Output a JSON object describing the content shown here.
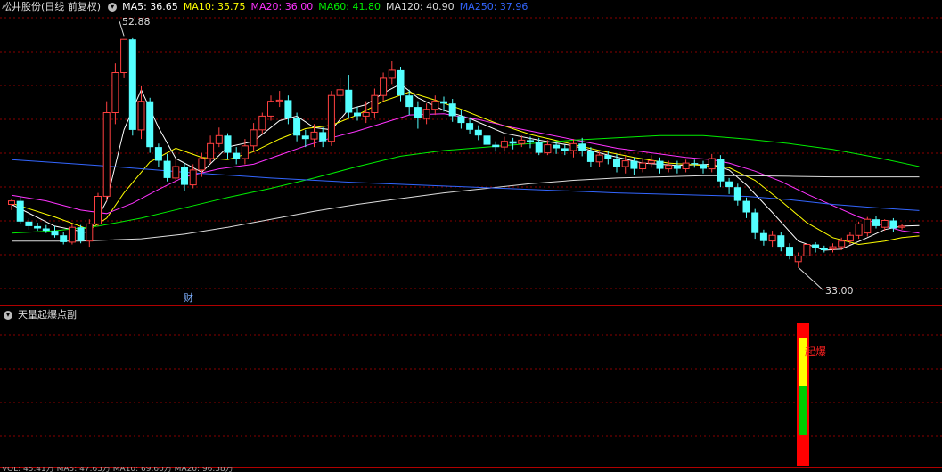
{
  "header": {
    "title": "松井股份(日线 前复权)",
    "ma": [
      {
        "label": "MA5: 36.65",
        "color": "#ffffff"
      },
      {
        "label": "MA10: 35.75",
        "color": "#ffff00"
      },
      {
        "label": "MA20: 36.00",
        "color": "#ff33ff"
      },
      {
        "label": "MA60: 41.80",
        "color": "#00ee00"
      },
      {
        "label": "MA120: 40.90",
        "color": "#dddddd"
      },
      {
        "label": "MA250: 37.96",
        "color": "#3366ff"
      }
    ]
  },
  "sub_panel": {
    "title": "天量起爆点副",
    "signal_text": "起爆",
    "bottom_text": "VOL: 45.41万  MA5: 47.63万  MA10: 69.60万  MA20: 96.38万"
  },
  "chart_data": {
    "type": "candlestick",
    "high_label": "52.88",
    "low_label": "33.00",
    "event_marker": "财",
    "ylim": [
      31,
      54
    ],
    "colors": {
      "up": "#ff4040",
      "down": "#54ffff",
      "grid": "#8a0000",
      "signal_red": "#ff0000",
      "signal_yellow": "#ffff00",
      "signal_green": "#00cc00"
    },
    "candles": [
      [
        38.5,
        38.8,
        38.0,
        39.0
      ],
      [
        38.8,
        37.0,
        36.8,
        39.2
      ],
      [
        37.0,
        36.6,
        36.3,
        37.3
      ],
      [
        36.6,
        36.4,
        36.2,
        36.9
      ],
      [
        36.4,
        36.2,
        36.0,
        36.7
      ],
      [
        36.2,
        35.8,
        35.6,
        36.6
      ],
      [
        35.8,
        35.2,
        35.0,
        36.1
      ],
      [
        35.2,
        36.5,
        35.0,
        36.8
      ],
      [
        36.5,
        35.3,
        35.1,
        36.7
      ],
      [
        35.3,
        36.8,
        34.8,
        37.2
      ],
      [
        36.8,
        39.2,
        36.6,
        39.5
      ],
      [
        39.2,
        46.5,
        38.8,
        47.5
      ],
      [
        46.5,
        50.0,
        45.5,
        50.8
      ],
      [
        50.0,
        52.9,
        49.5,
        52.88
      ],
      [
        52.9,
        45.0,
        44.5,
        53.0
      ],
      [
        45.0,
        47.5,
        44.2,
        48.8
      ],
      [
        47.5,
        43.5,
        43.0,
        47.8
      ],
      [
        43.5,
        42.3,
        41.8,
        43.8
      ],
      [
        42.3,
        40.8,
        40.5,
        42.9
      ],
      [
        40.8,
        41.8,
        40.3,
        42.5
      ],
      [
        41.8,
        40.2,
        39.7,
        42.1
      ],
      [
        40.2,
        41.5,
        39.9,
        42.0
      ],
      [
        41.5,
        42.5,
        40.9,
        43.0
      ],
      [
        42.5,
        43.8,
        42.1,
        44.5
      ],
      [
        43.8,
        44.5,
        43.5,
        45.2
      ],
      [
        44.5,
        43.0,
        42.5,
        44.7
      ],
      [
        43.0,
        42.5,
        42.0,
        43.5
      ],
      [
        42.5,
        43.6,
        42.0,
        44.2
      ],
      [
        43.6,
        45.0,
        43.1,
        45.6
      ],
      [
        45.0,
        46.2,
        44.6,
        46.5
      ],
      [
        46.2,
        47.5,
        45.8,
        48.0
      ],
      [
        47.5,
        47.6,
        47.0,
        48.4
      ],
      [
        47.6,
        46.0,
        45.5,
        48.0
      ],
      [
        46.0,
        44.5,
        44.0,
        46.5
      ],
      [
        44.5,
        44.2,
        43.5,
        45.0
      ],
      [
        44.2,
        44.8,
        43.5,
        45.5
      ],
      [
        44.8,
        44.0,
        43.5,
        45.2
      ],
      [
        44.0,
        48.0,
        43.6,
        48.4
      ],
      [
        48.0,
        48.5,
        47.4,
        49.5
      ],
      [
        48.5,
        46.5,
        46.0,
        49.8
      ],
      [
        46.5,
        46.2,
        45.8,
        47.0
      ],
      [
        46.2,
        46.5,
        45.6,
        47.5
      ],
      [
        46.5,
        48.0,
        46.0,
        48.6
      ],
      [
        48.0,
        49.5,
        47.5,
        50.0
      ],
      [
        49.5,
        50.2,
        49.0,
        51.0
      ],
      [
        50.2,
        48.0,
        47.5,
        50.5
      ],
      [
        48.0,
        47.0,
        46.3,
        48.5
      ],
      [
        47.0,
        46.0,
        45.1,
        47.5
      ],
      [
        46.0,
        46.8,
        45.5,
        47.3
      ],
      [
        46.8,
        47.5,
        46.3,
        48.0
      ],
      [
        47.5,
        47.3,
        46.6,
        47.9
      ],
      [
        47.3,
        46.2,
        45.7,
        47.7
      ],
      [
        46.2,
        45.6,
        45.1,
        46.7
      ],
      [
        45.6,
        45.0,
        44.6,
        46.1
      ],
      [
        45.0,
        44.5,
        44.1,
        45.4
      ],
      [
        44.5,
        43.7,
        43.2,
        44.9
      ],
      [
        43.7,
        43.5,
        43.1,
        44.0
      ],
      [
        43.5,
        44.0,
        43.1,
        44.4
      ],
      [
        44.0,
        43.8,
        43.3,
        44.3
      ],
      [
        43.8,
        44.1,
        43.5,
        44.5
      ],
      [
        44.1,
        43.9,
        43.4,
        44.4
      ],
      [
        43.9,
        43.0,
        42.8,
        44.3
      ],
      [
        43.0,
        43.7,
        42.8,
        44.1
      ],
      [
        43.7,
        43.4,
        42.9,
        44.0
      ],
      [
        43.4,
        43.2,
        42.8,
        43.7
      ],
      [
        43.2,
        43.8,
        42.6,
        44.2
      ],
      [
        43.8,
        43.2,
        42.7,
        44.3
      ],
      [
        43.2,
        42.2,
        41.8,
        43.5
      ],
      [
        42.2,
        42.8,
        41.8,
        43.1
      ],
      [
        42.8,
        42.5,
        42.0,
        43.2
      ],
      [
        42.5,
        41.8,
        41.3,
        42.9
      ],
      [
        41.8,
        42.3,
        41.2,
        42.7
      ],
      [
        42.3,
        41.6,
        41.1,
        42.6
      ],
      [
        41.6,
        42.1,
        41.3,
        42.5
      ],
      [
        42.1,
        42.3,
        41.7,
        42.8
      ],
      [
        42.3,
        41.6,
        41.2,
        42.6
      ],
      [
        41.6,
        41.9,
        41.3,
        42.3
      ],
      [
        41.9,
        41.6,
        41.2,
        42.3
      ],
      [
        41.6,
        42.1,
        41.3,
        42.4
      ],
      [
        42.1,
        42.0,
        41.7,
        42.4
      ],
      [
        42.0,
        41.6,
        41.2,
        42.3
      ],
      [
        41.6,
        42.5,
        41.3,
        42.9
      ],
      [
        42.5,
        40.5,
        40.0,
        42.8
      ],
      [
        40.5,
        40.0,
        39.4,
        40.8
      ],
      [
        40.0,
        38.8,
        38.4,
        40.3
      ],
      [
        38.8,
        37.8,
        37.3,
        39.1
      ],
      [
        37.8,
        36.0,
        35.5,
        38.1
      ],
      [
        36.0,
        35.3,
        34.9,
        36.3
      ],
      [
        35.3,
        35.8,
        34.8,
        36.2
      ],
      [
        35.8,
        34.8,
        34.4,
        36.1
      ],
      [
        34.8,
        34.0,
        33.7,
        35.1
      ],
      [
        33.5,
        34.0,
        33.0,
        34.3
      ],
      [
        34.0,
        35.0,
        33.8,
        35.1
      ],
      [
        35.0,
        34.7,
        34.3,
        35.2
      ],
      [
        34.7,
        34.5,
        34.3,
        34.9
      ],
      [
        34.6,
        34.8,
        34.3,
        35.1
      ],
      [
        34.8,
        35.3,
        34.5,
        35.6
      ],
      [
        35.3,
        35.8,
        35.0,
        36.1
      ],
      [
        35.8,
        36.8,
        35.5,
        37.0
      ],
      [
        36.0,
        37.2,
        35.7,
        37.4
      ],
      [
        37.2,
        36.6,
        36.4,
        37.5
      ],
      [
        36.5,
        37.1,
        36.2,
        37.2
      ],
      [
        37.1,
        36.4,
        36.1,
        37.3
      ],
      [
        36.5,
        36.6,
        36.3,
        36.8
      ]
    ],
    "ma_lines": [
      {
        "name": "MA5",
        "color": "#ffffff",
        "points": [
          [
            0,
            38.5
          ],
          [
            5,
            36.6
          ],
          [
            9,
            36.0
          ],
          [
            11,
            38.8
          ],
          [
            13,
            45.0
          ],
          [
            15,
            48.5
          ],
          [
            17,
            45.2
          ],
          [
            19,
            42.5
          ],
          [
            22,
            41.3
          ],
          [
            25,
            43.5
          ],
          [
            28,
            44.0
          ],
          [
            31,
            45.8
          ],
          [
            33,
            46.2
          ],
          [
            35,
            45.2
          ],
          [
            37,
            45.0
          ],
          [
            39,
            46.8
          ],
          [
            41,
            47.2
          ],
          [
            43,
            48.2
          ],
          [
            45,
            49.0
          ],
          [
            47,
            47.8
          ],
          [
            50,
            46.7
          ],
          [
            53,
            46.0
          ],
          [
            57,
            44.7
          ],
          [
            61,
            44.1
          ],
          [
            65,
            43.6
          ],
          [
            69,
            42.8
          ],
          [
            73,
            42.1
          ],
          [
            77,
            41.9
          ],
          [
            81,
            42.0
          ],
          [
            83,
            41.5
          ],
          [
            85,
            40.2
          ],
          [
            88,
            37.8
          ],
          [
            91,
            35.3
          ],
          [
            94,
            34.5
          ],
          [
            96,
            34.6
          ],
          [
            99,
            35.6
          ],
          [
            101,
            36.3
          ],
          [
            103,
            36.6
          ],
          [
            105,
            36.65
          ]
        ]
      },
      {
        "name": "MA10",
        "color": "#ffff00",
        "points": [
          [
            0,
            38.6
          ],
          [
            5,
            37.4
          ],
          [
            9,
            36.3
          ],
          [
            11,
            37.3
          ],
          [
            13,
            39.5
          ],
          [
            16,
            42.2
          ],
          [
            19,
            43.4
          ],
          [
            22,
            42.6
          ],
          [
            25,
            42.4
          ],
          [
            28,
            43.1
          ],
          [
            31,
            44.2
          ],
          [
            34,
            45.1
          ],
          [
            37,
            45.4
          ],
          [
            40,
            46.3
          ],
          [
            43,
            47.5
          ],
          [
            46,
            48.3
          ],
          [
            49,
            47.6
          ],
          [
            52,
            46.8
          ],
          [
            56,
            45.6
          ],
          [
            60,
            44.6
          ],
          [
            64,
            43.9
          ],
          [
            68,
            43.2
          ],
          [
            72,
            42.6
          ],
          [
            76,
            42.1
          ],
          [
            80,
            41.9
          ],
          [
            83,
            41.7
          ],
          [
            86,
            40.6
          ],
          [
            89,
            38.8
          ],
          [
            92,
            36.9
          ],
          [
            95,
            35.6
          ],
          [
            98,
            35.0
          ],
          [
            101,
            35.3
          ],
          [
            103,
            35.6
          ],
          [
            105,
            35.75
          ]
        ]
      },
      {
        "name": "MA20",
        "color": "#ff33ff",
        "points": [
          [
            0,
            39.3
          ],
          [
            4,
            38.8
          ],
          [
            8,
            38.0
          ],
          [
            11,
            37.7
          ],
          [
            14,
            38.6
          ],
          [
            17,
            39.8
          ],
          [
            20,
            40.9
          ],
          [
            24,
            41.6
          ],
          [
            28,
            42.0
          ],
          [
            31,
            42.8
          ],
          [
            34,
            43.6
          ],
          [
            37,
            44.3
          ],
          [
            40,
            44.9
          ],
          [
            43,
            45.6
          ],
          [
            46,
            46.3
          ],
          [
            50,
            46.4
          ],
          [
            54,
            45.9
          ],
          [
            58,
            45.2
          ],
          [
            62,
            44.6
          ],
          [
            66,
            44.0
          ],
          [
            70,
            43.4
          ],
          [
            74,
            43.0
          ],
          [
            78,
            42.6
          ],
          [
            81,
            42.4
          ],
          [
            83,
            42.1
          ],
          [
            86,
            41.4
          ],
          [
            89,
            40.5
          ],
          [
            92,
            39.4
          ],
          [
            95,
            38.4
          ],
          [
            98,
            37.4
          ],
          [
            101,
            36.6
          ],
          [
            103,
            36.2
          ],
          [
            105,
            36.0
          ]
        ]
      },
      {
        "name": "MA60",
        "color": "#00ee00",
        "points": [
          [
            0,
            36.0
          ],
          [
            5,
            36.2
          ],
          [
            10,
            36.6
          ],
          [
            15,
            37.3
          ],
          [
            20,
            38.2
          ],
          [
            25,
            39.1
          ],
          [
            30,
            39.9
          ],
          [
            35,
            40.8
          ],
          [
            40,
            41.8
          ],
          [
            45,
            42.7
          ],
          [
            50,
            43.2
          ],
          [
            55,
            43.5
          ],
          [
            60,
            43.8
          ],
          [
            65,
            44.1
          ],
          [
            70,
            44.3
          ],
          [
            75,
            44.5
          ],
          [
            80,
            44.5
          ],
          [
            85,
            44.2
          ],
          [
            90,
            43.8
          ],
          [
            95,
            43.3
          ],
          [
            100,
            42.6
          ],
          [
            105,
            41.8
          ]
        ]
      },
      {
        "name": "MA120",
        "color": "#dddddd",
        "points": [
          [
            0,
            35.3
          ],
          [
            8,
            35.3
          ],
          [
            15,
            35.5
          ],
          [
            20,
            35.9
          ],
          [
            25,
            36.5
          ],
          [
            30,
            37.2
          ],
          [
            35,
            37.9
          ],
          [
            40,
            38.5
          ],
          [
            45,
            39.0
          ],
          [
            50,
            39.5
          ],
          [
            55,
            39.9
          ],
          [
            60,
            40.3
          ],
          [
            65,
            40.6
          ],
          [
            70,
            40.8
          ],
          [
            75,
            40.9
          ],
          [
            80,
            41.0
          ],
          [
            85,
            41.0
          ],
          [
            90,
            40.95
          ],
          [
            95,
            40.9
          ],
          [
            100,
            40.9
          ],
          [
            105,
            40.9
          ]
        ]
      },
      {
        "name": "MA250",
        "color": "#3366ff",
        "points": [
          [
            0,
            42.4
          ],
          [
            10,
            41.9
          ],
          [
            20,
            41.3
          ],
          [
            30,
            40.8
          ],
          [
            40,
            40.4
          ],
          [
            50,
            40.1
          ],
          [
            60,
            39.8
          ],
          [
            70,
            39.5
          ],
          [
            80,
            39.3
          ],
          [
            85,
            39.2
          ],
          [
            90,
            38.9
          ],
          [
            95,
            38.5
          ],
          [
            100,
            38.2
          ],
          [
            105,
            37.96
          ]
        ]
      }
    ]
  }
}
